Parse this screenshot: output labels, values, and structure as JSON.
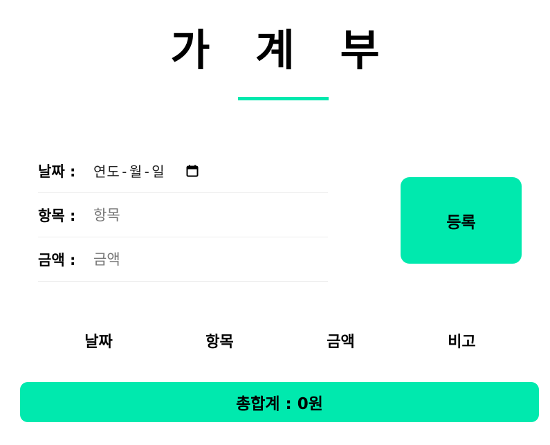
{
  "title": "가 계 부",
  "accent_color": "#00e9ae",
  "form": {
    "date": {
      "label": "날짜 :",
      "placeholder_text": "연도-월-일",
      "icon": "calendar-icon"
    },
    "item": {
      "label": "항목 :",
      "placeholder": "항목",
      "value": ""
    },
    "amount": {
      "label": "금액 :",
      "placeholder": "금액",
      "value": ""
    },
    "submit_label": "등록"
  },
  "table": {
    "columns": [
      "날짜",
      "항목",
      "금액",
      "비고"
    ]
  },
  "total": {
    "text": "총합계 : 0원"
  }
}
